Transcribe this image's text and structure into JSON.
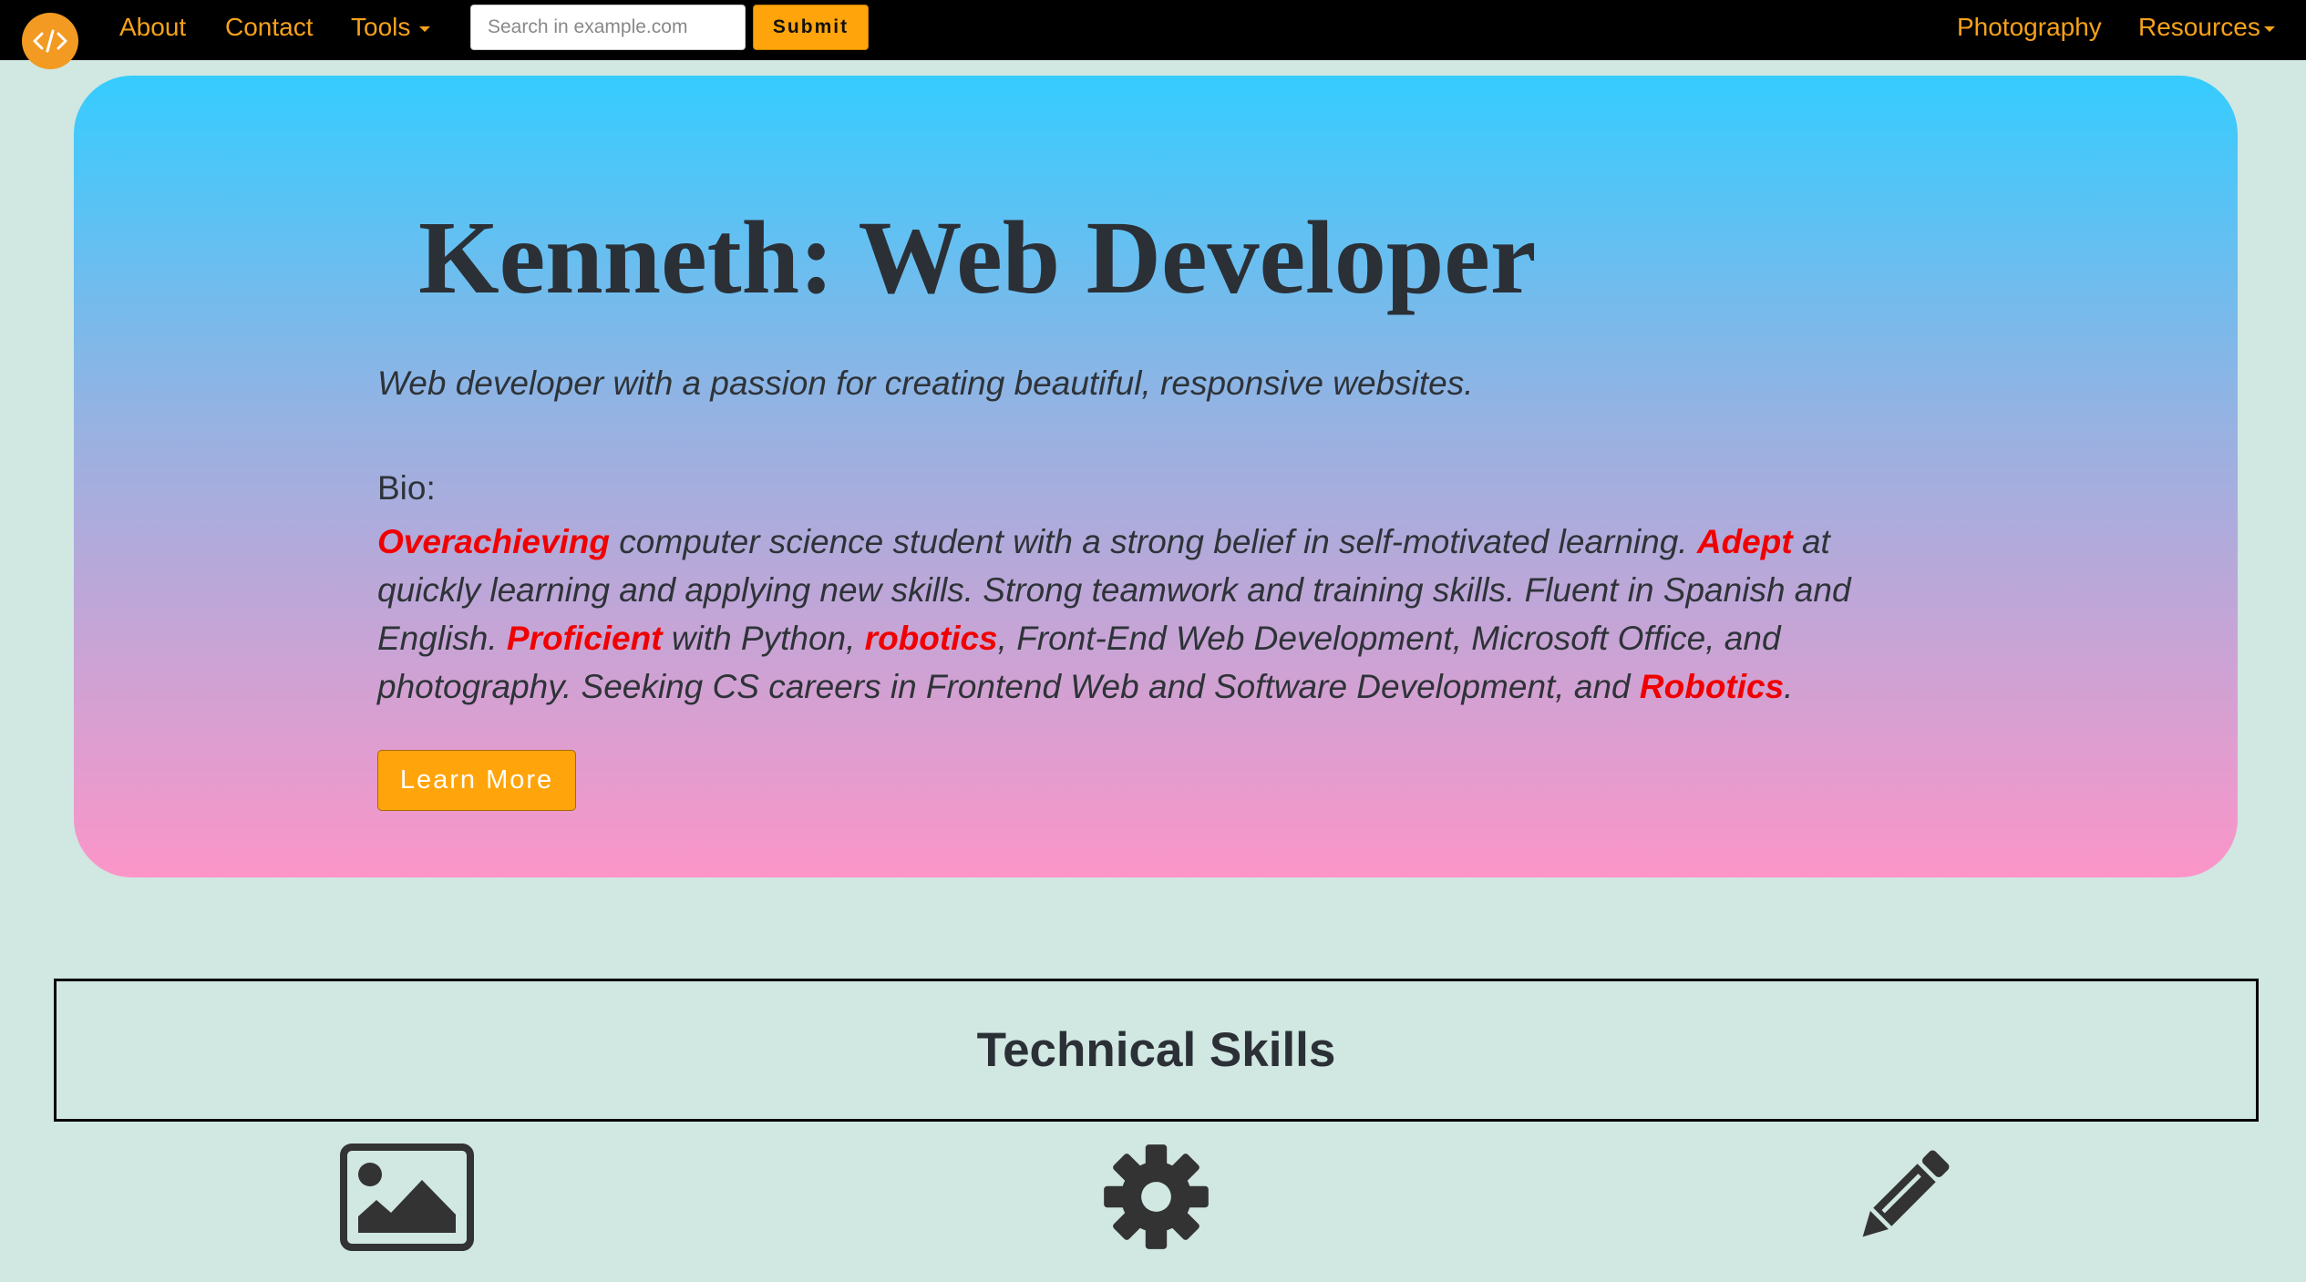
{
  "navbar": {
    "logo_icon": "code-icon",
    "links": {
      "about": "About",
      "contact": "Contact",
      "tools": "Tools",
      "photography": "Photography",
      "resources": "Resources"
    },
    "search": {
      "placeholder": "Search in example.com",
      "value": ""
    },
    "submit_label": "Submit",
    "link_color": "#f6a21a"
  },
  "hero": {
    "title": "Kenneth: Web Developer",
    "tagline": "Web developer with a passion for creating beautiful, responsive websites.",
    "bio_label": "Bio:",
    "bio": {
      "w1": "Overachieving",
      "t1": " computer science student with a strong belief in self-motivated learning. ",
      "w2": "Adept",
      "t2": " at quickly learning and applying new skills. Strong teamwork and training skills. Fluent in Spanish and English. ",
      "w3": "Proficient",
      "t3": " with Python, ",
      "w4": "robotics",
      "t4": ", Front-End Web Development, Microsoft Office, and photography. Seeking CS careers in Frontend Web and Software Development, and ",
      "w5": "Robotics",
      "t5": "."
    },
    "highlight_color": "#f00000",
    "button_label": "Learn More"
  },
  "skills": {
    "title": "Technical Skills",
    "icons": [
      "image-icon",
      "gear-icon",
      "pencil-icon"
    ]
  }
}
